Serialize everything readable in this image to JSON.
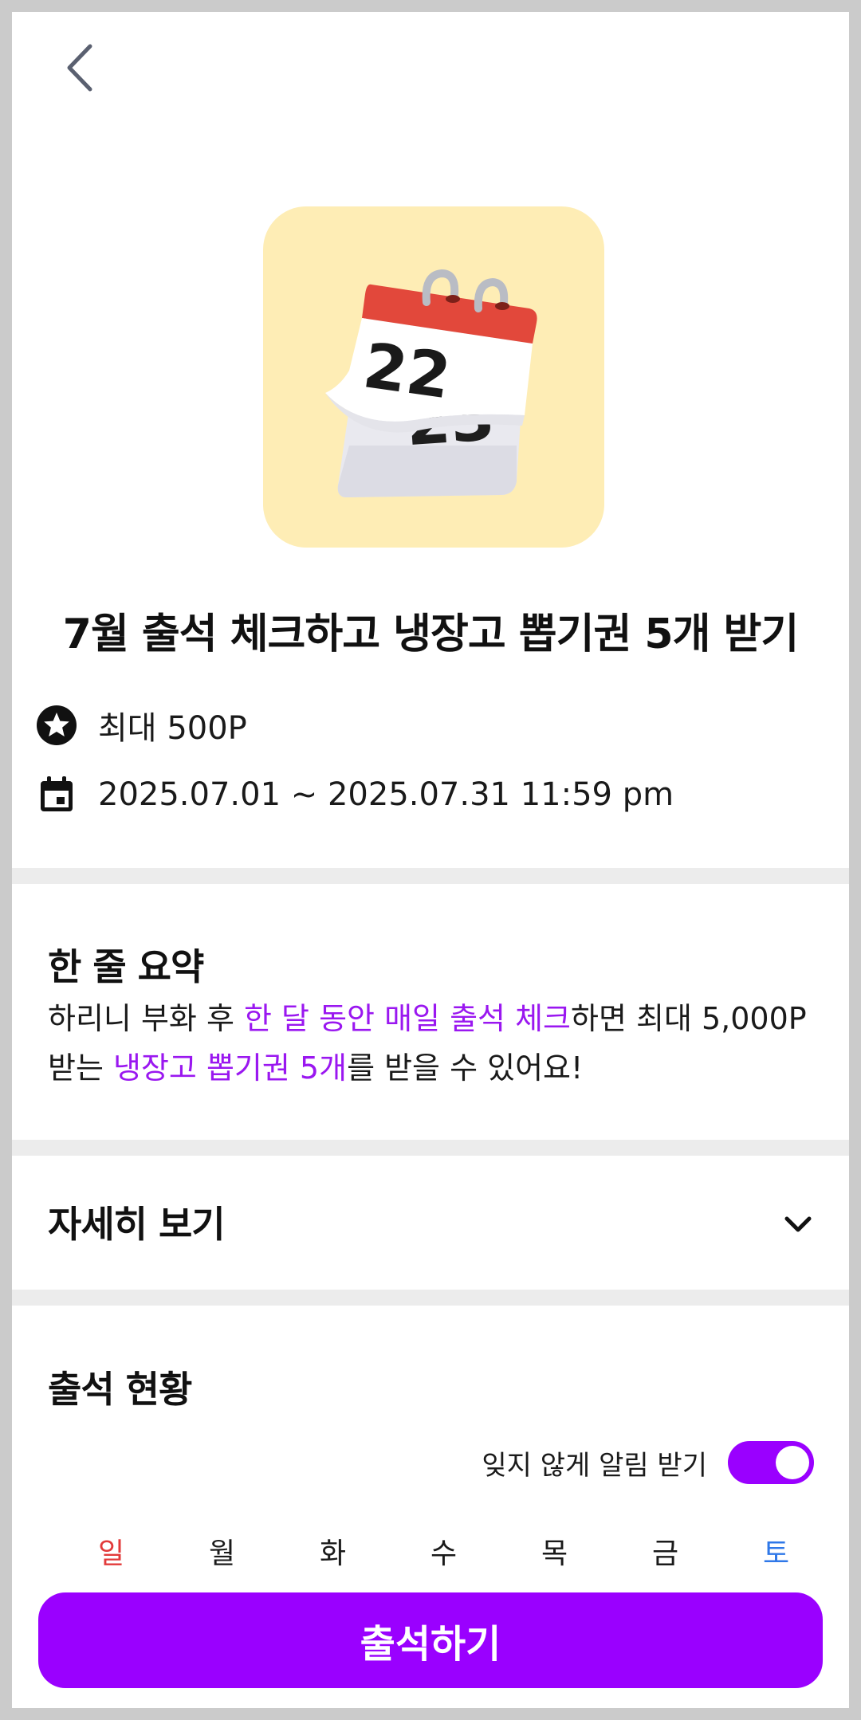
{
  "header": {
    "back_icon": "chevron-left-icon"
  },
  "hero": {
    "image": "calendar-illustration",
    "calendar_day": "22",
    "background_color": "#feedb5"
  },
  "title": "7월 출석 체크하고 냉장고 뽑기권 5개 받기",
  "info": {
    "reward": {
      "icon": "star-circle-icon",
      "text": "최대 500P"
    },
    "period": {
      "icon": "calendar-icon",
      "text": "2025.07.01 ~ 2025.07.31 11:59 pm"
    }
  },
  "summary": {
    "heading": "한 줄 요약",
    "parts": [
      {
        "text": "하리니 부화 후 ",
        "highlight": false
      },
      {
        "text": "한 달 동안 매일 출석 체크",
        "highlight": true
      },
      {
        "text": "하면 최대 5,000P 받는 ",
        "highlight": false
      },
      {
        "text": "냉장고 뽑기권 5개",
        "highlight": true
      },
      {
        "text": "를 받을 수 있어요!",
        "highlight": false
      }
    ],
    "highlight_color": "#9a17f0"
  },
  "details": {
    "heading": "자세히 보기",
    "icon": "chevron-down-icon"
  },
  "attendance": {
    "heading": "출석 현황",
    "notify_label": "잊지 않게 알림 받기",
    "notify_on": true,
    "weekdays": [
      "일",
      "월",
      "화",
      "수",
      "목",
      "금",
      "토"
    ]
  },
  "cta": {
    "label": "출석하기",
    "color": "#9a00ff"
  }
}
